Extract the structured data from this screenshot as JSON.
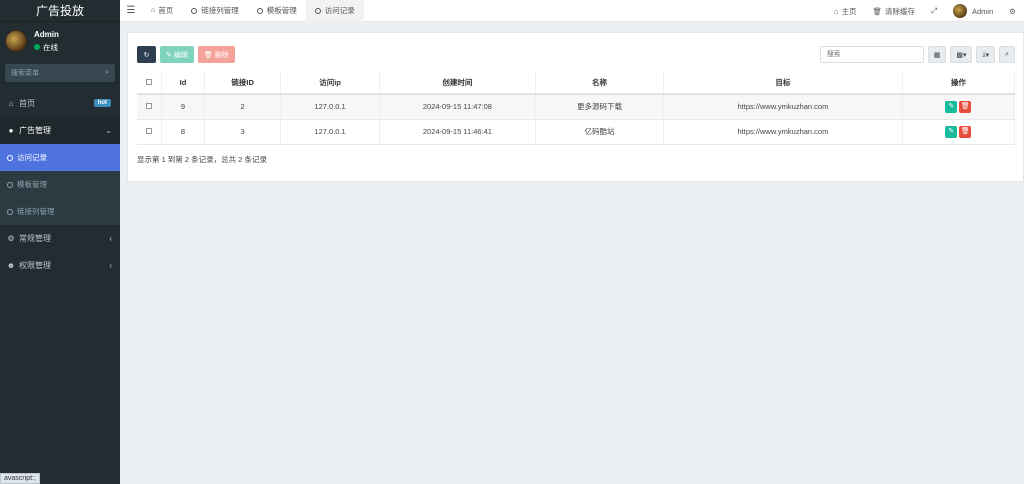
{
  "app": {
    "title": "广告投放"
  },
  "user": {
    "name": "Admin",
    "status": "在线"
  },
  "sidebar": {
    "search_placeholder": "搜索菜单",
    "items": [
      {
        "label": "首页",
        "badge": "hot",
        "icon": "home-icon"
      },
      {
        "label": "广告管理",
        "icon": "ad-icon",
        "expanded": true,
        "children": [
          {
            "label": "访问记录",
            "active": true
          },
          {
            "label": "模板管理"
          },
          {
            "label": "链接列管理"
          }
        ]
      },
      {
        "label": "常规管理",
        "icon": "gears-icon"
      },
      {
        "label": "权限管理",
        "icon": "users-icon"
      }
    ]
  },
  "topbar": {
    "tabs": [
      {
        "label": "首页"
      },
      {
        "label": "链接列管理"
      },
      {
        "label": "模板管理"
      },
      {
        "label": "访问记录",
        "active": true
      }
    ],
    "right": {
      "home": "主页",
      "clear_cache": "清除缓存",
      "user": "Admin"
    }
  },
  "toolbar": {
    "edit": "编辑",
    "delete": "删除",
    "search_placeholder": "搜索"
  },
  "table": {
    "columns": [
      "Id",
      "链接ID",
      "访问ip",
      "创建时间",
      "名称",
      "目标",
      "操作"
    ],
    "rows": [
      {
        "id": "9",
        "link_id": "2",
        "ip": "127.0.0.1",
        "created": "2024-09-15 11:47:08",
        "name": "更多源码下载",
        "target": "https://www.ymkuzhan.com"
      },
      {
        "id": "8",
        "link_id": "3",
        "ip": "127.0.0.1",
        "created": "2024-09-15 11:46:41",
        "name": "亿码酷站",
        "target": "https://www.ymkuzhan.com"
      }
    ]
  },
  "pagination": {
    "summary": "显示第 1 到第 2 条记录，总共 2 条记录"
  },
  "statusbar": {
    "text": "avascript:;"
  },
  "colors": {
    "sidebar_bg": "#222d32",
    "active_item": "#4e73df",
    "edit_green": "#18bc9c",
    "delete_red": "#e74c3c"
  }
}
